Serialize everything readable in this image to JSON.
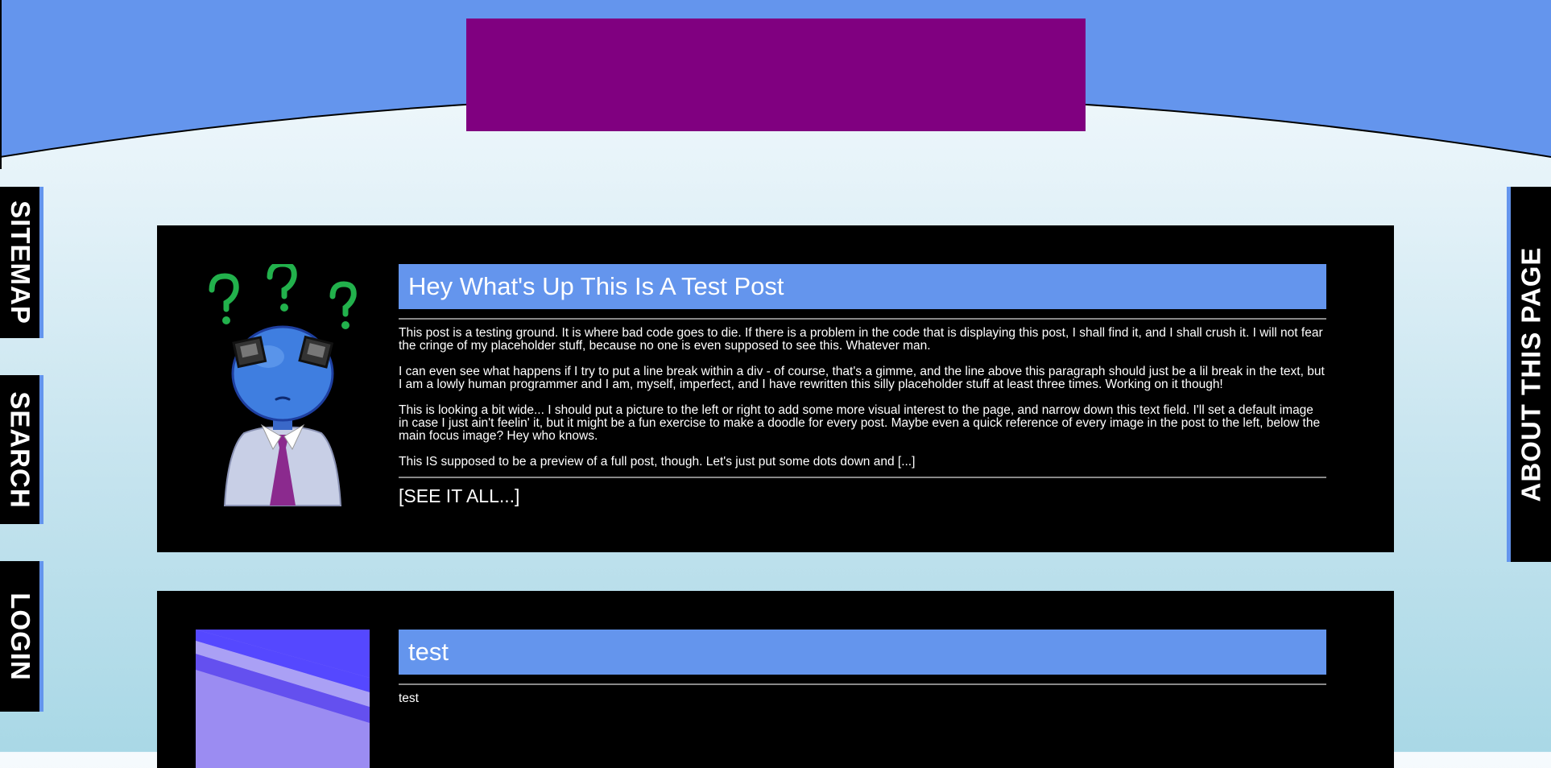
{
  "colors": {
    "header_blue": "#6495ed",
    "banner": "#800080",
    "panel": "#000000",
    "title_bar": "#6495ed"
  },
  "sidenav": {
    "left": [
      "SITEMAP",
      "SEARCH",
      "LOGIN"
    ],
    "right": "ABOUT THIS PAGE"
  },
  "posts": [
    {
      "title": "Hey What's Up This Is A Test Post",
      "paragraphs": [
        "This post is a testing ground. It is where bad code goes to die. If there is a problem in the code that is displaying this post, I shall find it, and I shall crush it. I will not fear the cringe of my placeholder stuff, because no one is even supposed to see this. Whatever man.",
        "I can even see what happens if I try to put a line break within a div - of course, that's a gimme, and the line above this paragraph should just be a lil break in the text, but I am a lowly human programmer and I am, myself, imperfect, and I have rewritten this silly placeholder stuff at least three times. Working on it though!",
        "This is looking a bit wide... I should put a picture to the left or right to add some more visual interest to the page, and narrow down this text field. I'll set a default image in case I just ain't feelin' it, but it might be a fun exercise to make a doodle for every post. Maybe even a quick reference of every image in the post to the left, below the main focus image? Hey who knows.",
        "This IS supposed to be a preview of a full post, though. Let's just put some dots down and [...]"
      ],
      "see_all": "[SEE IT ALL...]",
      "thumb_icon": "confused-blue-character-image"
    },
    {
      "title": "test",
      "paragraphs": [
        "test"
      ],
      "thumb_icon": "purple-stripes-image"
    }
  ]
}
